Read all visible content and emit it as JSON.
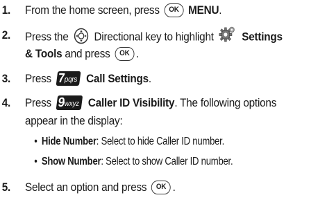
{
  "steps": [
    {
      "number": "1.",
      "pre": "From the home screen, press",
      "key_icon": "ok-key-icon",
      "menu": "MENU",
      "post": "."
    },
    {
      "number": "2.",
      "pre": "Press the",
      "key_icon": "directional-key-icon",
      "mid": "Directional key to highlight",
      "menu_icon": "settings-gear-icon",
      "menu_line1": "Settings",
      "menu_line2": "& Tools",
      "post_pre": "and press",
      "key_icon_2": "ok-key-icon",
      "post": "."
    },
    {
      "number": "3.",
      "pre": "Press",
      "key_label_big": "7",
      "key_label_small": "pqrs",
      "menu": "Call Settings",
      "post": "."
    },
    {
      "number": "4.",
      "pre": "Press",
      "key_label_big": "9",
      "key_label_small": "wxyz",
      "menu": "Caller ID Visibility",
      "post": ". The following options",
      "line2": "appear in the display:",
      "options": [
        {
          "bullet": "•",
          "name": "Hide Number",
          "desc": ": Select to hide Caller ID number."
        },
        {
          "bullet": "•",
          "name": "Show Number",
          "desc": ": Select to show Caller ID number."
        }
      ]
    },
    {
      "number": "5.",
      "pre": "Select an option and press",
      "key_icon": "ok-key-icon",
      "post": "."
    }
  ],
  "ok_key_label": "OK"
}
